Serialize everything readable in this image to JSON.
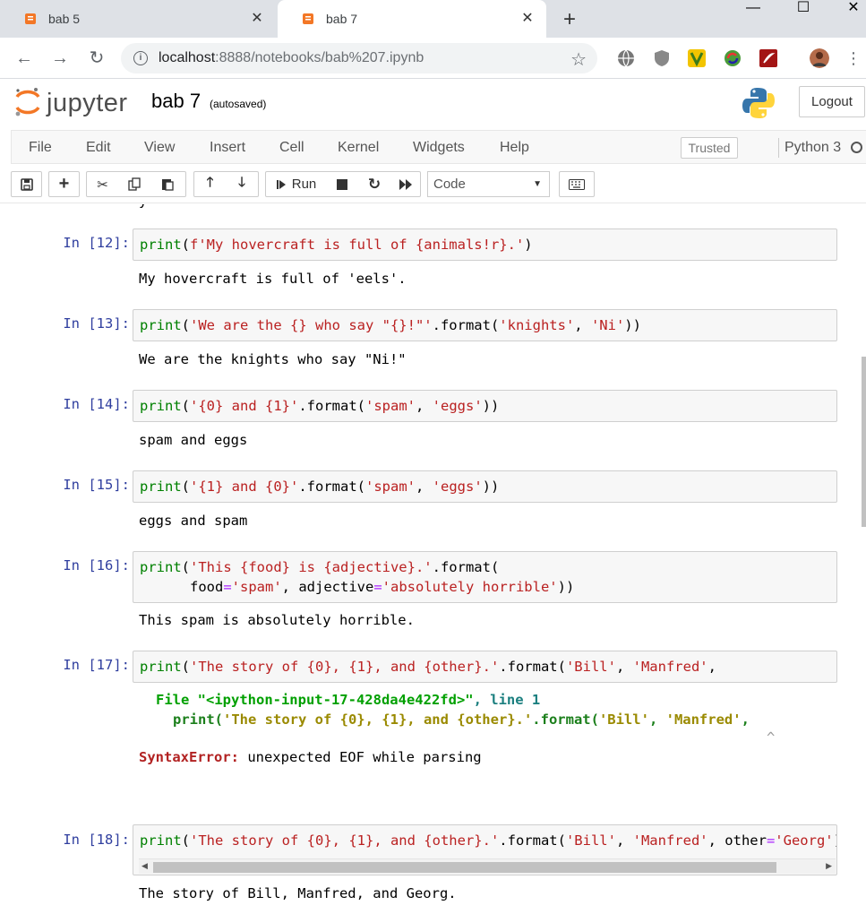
{
  "browser": {
    "tabs": [
      {
        "title": "bab 5",
        "active": false
      },
      {
        "title": "bab 7",
        "active": true
      }
    ],
    "url_host": "localhost",
    "url_rest": ":8888/notebooks/bab%207.ipynb"
  },
  "jupyter": {
    "logo_text": "jupyter",
    "notebook_name": "bab 7",
    "save_status": "(autosaved)",
    "logout_label": "Logout",
    "menu": [
      "File",
      "Edit",
      "View",
      "Insert",
      "Cell",
      "Kernel",
      "Widgets",
      "Help"
    ],
    "trusted_label": "Trusted",
    "kernel_name": "Python 3",
    "toolbar": {
      "run_label": "Run",
      "cell_type": "Code"
    }
  },
  "cells": [
    {
      "prompt": "In [12]:",
      "output": "My hovercraft is full of 'eels'."
    },
    {
      "prompt": "In [13]:",
      "output": "We are the knights who say \"Ni!\""
    },
    {
      "prompt": "In [14]:",
      "output": "spam and eggs"
    },
    {
      "prompt": "In [15]:",
      "output": "eggs and spam"
    },
    {
      "prompt": "In [16]:",
      "output": "This spam is absolutely horrible."
    },
    {
      "prompt": "In [17]:",
      "traceback_file": "File \"<ipython-input-17-428da4e422fd>\"",
      "traceback_line": ", line 1",
      "traceback_code": "print('The story of {0}, {1}, and {other}.'.format('Bill', 'Manfred',",
      "traceback_caret": "^",
      "error_name": "SyntaxError:",
      "error_msg": " unexpected EOF while parsing"
    },
    {
      "prompt": "In [18]:",
      "output": "The story of Bill, Manfred, and Georg."
    }
  ],
  "colors": {
    "prompt_blue": "#303f9f",
    "keyword_green": "#008000",
    "string_red": "#ba2121",
    "operator_purple": "#aa22ff"
  }
}
